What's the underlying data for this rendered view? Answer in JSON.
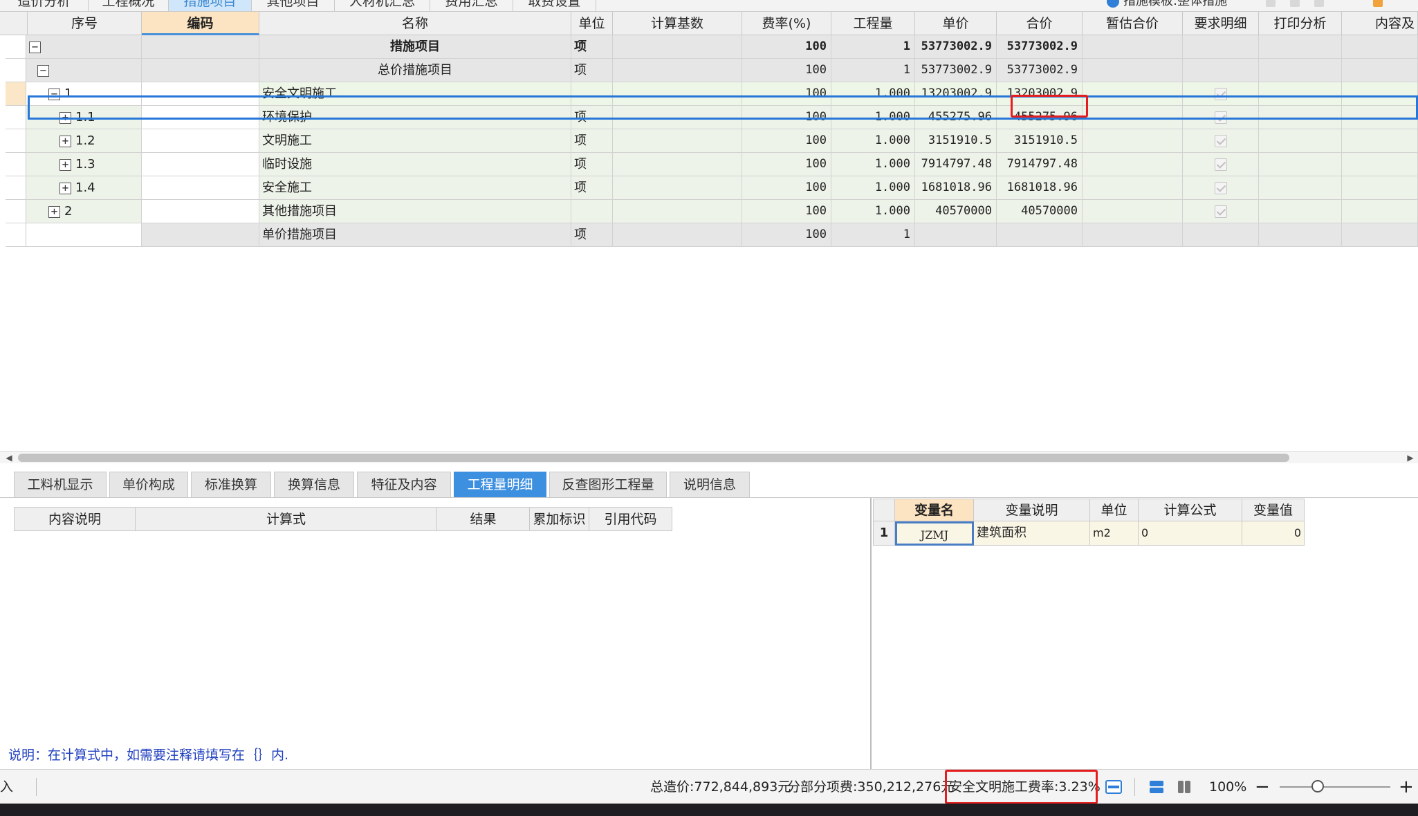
{
  "top_tabs": [
    "造价分析",
    "工程概况",
    "措施项目",
    "其他项目",
    "人材机汇总",
    "费用汇总",
    "取费设置"
  ],
  "top_tabs_active": 2,
  "top_right_status": "措施模板:整体措施",
  "grid": {
    "headers": [
      "序号",
      "编码",
      "名称",
      "单位",
      "计算基数",
      "费率(%)",
      "工程量",
      "单价",
      "合价",
      "暂估合价",
      "要求明细",
      "打印分析",
      "内容及"
    ],
    "selected_header": 1,
    "rows": [
      {
        "seq": "",
        "toggle": "−",
        "name": "措施项目",
        "unit": "项",
        "base": "",
        "rate": "100",
        "qty": "1",
        "price": "53773002.9",
        "total": "53773002.9",
        "check": false
      },
      {
        "seq": "",
        "toggle": "−",
        "name": "总价措施项目",
        "unit": "项",
        "base": "",
        "rate": "100",
        "qty": "1",
        "price": "53773002.9",
        "total": "53773002.9",
        "check": false
      },
      {
        "seq": "1",
        "toggle": "−",
        "name": "安全文明施工",
        "unit": "",
        "base": "",
        "rate": "100",
        "qty": "1.000",
        "price": "13203002.9",
        "total": "13203002.9",
        "check": true
      },
      {
        "seq": "1.1",
        "toggle": "+",
        "name": "环境保护",
        "unit": "项",
        "base": "",
        "rate": "100",
        "qty": "1.000",
        "price": "455275.96",
        "total": "455275.96",
        "check": true
      },
      {
        "seq": "1.2",
        "toggle": "+",
        "name": "文明施工",
        "unit": "项",
        "base": "",
        "rate": "100",
        "qty": "1.000",
        "price": "3151910.5",
        "total": "3151910.5",
        "check": true
      },
      {
        "seq": "1.3",
        "toggle": "+",
        "name": "临时设施",
        "unit": "项",
        "base": "",
        "rate": "100",
        "qty": "1.000",
        "price": "7914797.48",
        "total": "7914797.48",
        "check": true
      },
      {
        "seq": "1.4",
        "toggle": "+",
        "name": "安全施工",
        "unit": "项",
        "base": "",
        "rate": "100",
        "qty": "1.000",
        "price": "1681018.96",
        "total": "1681018.96",
        "check": true
      },
      {
        "seq": "2",
        "toggle": "+",
        "name": "其他措施项目",
        "unit": "",
        "base": "",
        "rate": "100",
        "qty": "1.000",
        "price": "40570000",
        "total": "40570000",
        "check": true
      },
      {
        "seq": "",
        "toggle": "",
        "name": "单价措施项目",
        "unit": "项",
        "base": "",
        "rate": "100",
        "qty": "1",
        "price": "",
        "total": "",
        "check": false
      }
    ]
  },
  "bottom_tabs": [
    "工料机显示",
    "单价构成",
    "标准换算",
    "换算信息",
    "特征及内容",
    "工程量明细",
    "反查图形工程量",
    "说明信息"
  ],
  "bottom_tabs_active": 5,
  "left_panel": {
    "headers": [
      "内容说明",
      "计算式",
      "结果",
      "累加标识",
      "引用代码"
    ],
    "note": "说明：在计算式中，如需要注释请填写在｛｝内."
  },
  "right_panel": {
    "headers": [
      "变量名",
      "变量说明",
      "单位",
      "计算公式",
      "变量值"
    ],
    "rows": [
      {
        "idx": "1",
        "var": "JZMJ",
        "desc": "建筑面积",
        "unit": "m2",
        "formula": "0",
        "value": "0"
      }
    ]
  },
  "status": {
    "left_text": "入",
    "total_cost": "总造价:772,844,893元",
    "sub_cost": "分部分项费:350,212,276元",
    "safety_rate": "安全文明施工费率:3.23%",
    "zoom": "100%",
    "zoom_minus": "−",
    "zoom_plus": "+"
  },
  "colors": {
    "accent": "#3d8fe0",
    "selection": "#2677d9",
    "highlight": "#e41e1e",
    "row_green": "#eef6e8",
    "row_grey": "#e6e6e6"
  }
}
